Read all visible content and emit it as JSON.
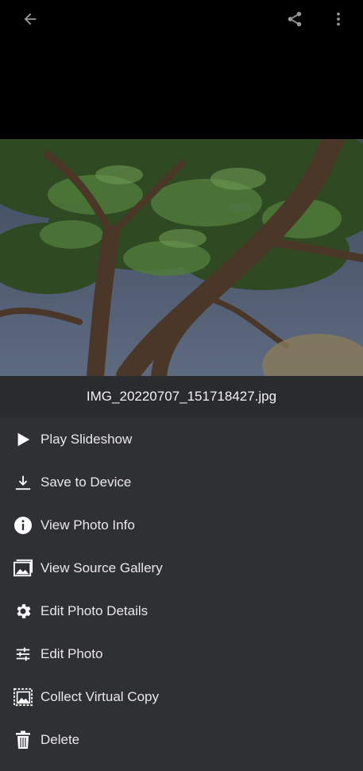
{
  "topbar": {
    "back_icon": "arrow-left-icon",
    "share_icon": "share-icon",
    "more_icon": "more-vert-icon"
  },
  "photo": {
    "filename": "IMG_20220707_151718427.jpg"
  },
  "menu": {
    "items": [
      {
        "label": "Play Slideshow",
        "icon": "play-icon"
      },
      {
        "label": "Save to Device",
        "icon": "download-icon"
      },
      {
        "label": "View Photo Info",
        "icon": "info-icon"
      },
      {
        "label": "View Source Gallery",
        "icon": "gallery-icon"
      },
      {
        "label": "Edit Photo Details",
        "icon": "gear-icon"
      },
      {
        "label": "Edit Photo",
        "icon": "sliders-icon"
      },
      {
        "label": "Collect Virtual Copy",
        "icon": "virtual-copy-icon"
      },
      {
        "label": "Delete",
        "icon": "trash-icon"
      }
    ]
  },
  "colors": {
    "menu_bg": "#2f3033",
    "filename_bar_bg": "#2a2b2e",
    "text": "#e8e8e8"
  }
}
